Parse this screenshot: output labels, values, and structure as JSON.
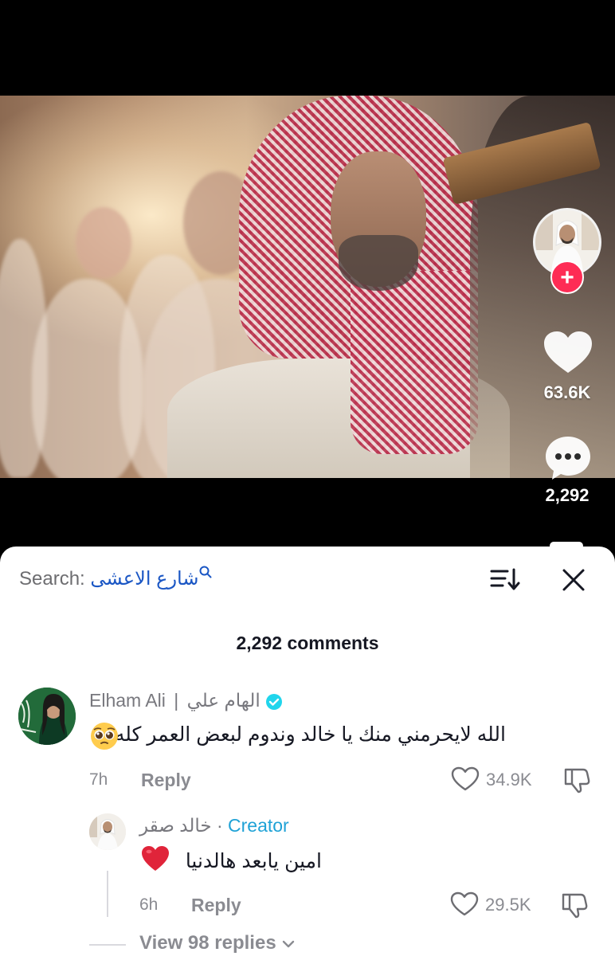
{
  "video": {
    "like_count": "63.6K",
    "comment_count": "2,292",
    "creator_avatar_icon": "creator-avatar",
    "follow_symbol": "+"
  },
  "search": {
    "label": "Search:",
    "term": "شارع الاعشى"
  },
  "header": {
    "comments_count": "2,292 comments"
  },
  "comments": [
    {
      "display_name": "Elham Ali",
      "separator": "|",
      "arabic_name": "الهام علي",
      "verified": true,
      "text": "الله لايحرمني منك يا خالد وندوم لبعض العمر كله",
      "emoji": "pleading-face",
      "time": "7h",
      "reply_label": "Reply",
      "likes": "34.9K"
    }
  ],
  "reply": {
    "display_name": "خالد صقر",
    "dot": "·",
    "creator_label": "Creator",
    "text": "امين يابعد هالدنيا",
    "emoji": "red-heart",
    "time": "6h",
    "reply_label": "Reply",
    "likes": "29.5K"
  },
  "footer": {
    "view_replies": "View 98 replies"
  },
  "colors": {
    "accent_red": "#fe2c55",
    "link_blue": "#1a56c4",
    "creator_blue": "#1fa2d6",
    "muted_gray": "#8a8b91"
  }
}
